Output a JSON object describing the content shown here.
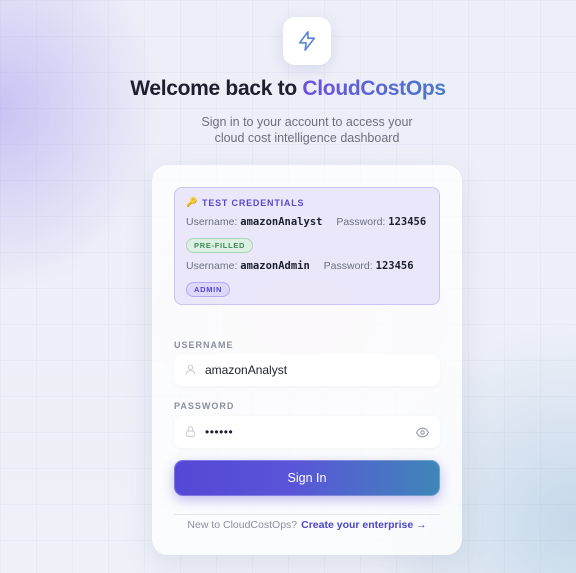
{
  "header": {
    "title_prefix": "Welcome back to",
    "brand": "CloudCostOps",
    "subtitle": "Sign in to your account to access your cloud cost intelligence dashboard"
  },
  "credentials": {
    "heading": "TEST CREDENTIALS",
    "username_label": "Username:",
    "password_label": "Password:",
    "accounts": [
      {
        "username": "amazonAnalyst",
        "password": "123456",
        "badge": "PRE-FILLED"
      },
      {
        "username": "amazonAdmin",
        "password": "123456",
        "badge": "ADMIN"
      }
    ]
  },
  "form": {
    "username_label": "USERNAME",
    "username_value": "amazonAnalyst",
    "password_label": "PASSWORD",
    "password_masked": "••••••",
    "submit_label": "Sign In"
  },
  "footer": {
    "prompt": "New to CloudCostOps?",
    "link": "Create your enterprise →"
  },
  "icons": {
    "logo": "lightning-icon",
    "key": "key-icon",
    "user": "user-icon",
    "lock": "lock-icon",
    "eye": "eye-icon"
  },
  "colors": {
    "accent": "#5447d6",
    "brand_gradient_start": "#6d4fe0",
    "brand_gradient_end": "#4a7bc8",
    "success": "#3f8a57"
  }
}
